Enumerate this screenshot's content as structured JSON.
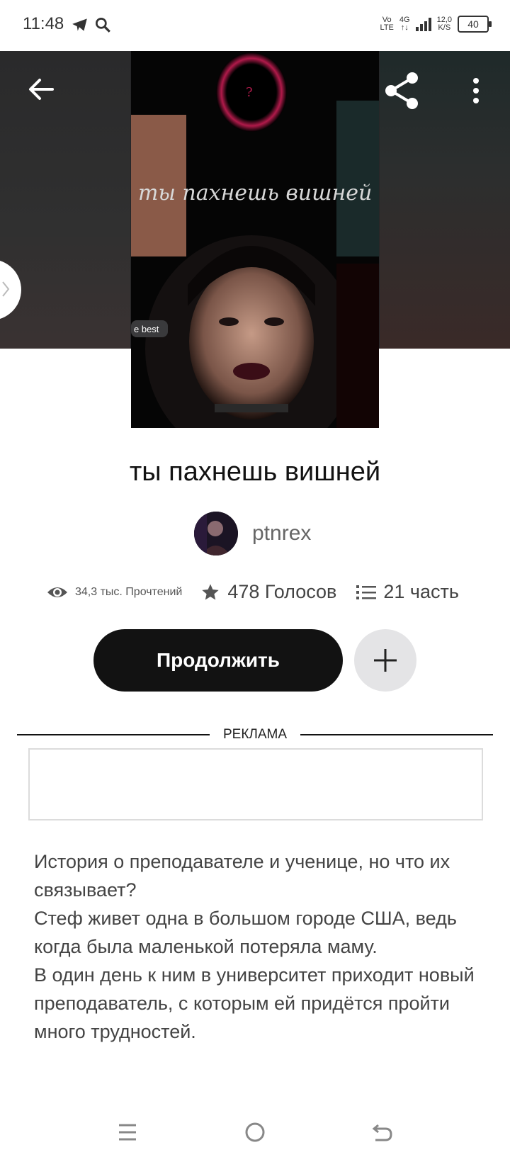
{
  "status_bar": {
    "time": "11:48",
    "icons": [
      "telegram-icon",
      "search-icon"
    ],
    "network_top": "Vo",
    "network_bottom": "LTE",
    "net_type": "4G",
    "speed_value": "12,0",
    "speed_unit": "K/S",
    "battery": "40"
  },
  "header": {
    "back_icon": "arrow-left-icon",
    "share_icon": "share-icon",
    "more_icon": "more-vertical-icon",
    "cover_text": "ты пахнешь вишней",
    "cover_badge": "e best",
    "cover_question": "?"
  },
  "story": {
    "title": "ты пахнешь вишней",
    "author": "ptnrex",
    "reads": "34,3 тыс. Прочтений",
    "votes": "478 Голосов",
    "parts": "21 часть"
  },
  "actions": {
    "continue_label": "Продолжить",
    "add_icon": "plus-icon"
  },
  "ad": {
    "label": "РЕКЛАМА"
  },
  "description": {
    "paragraphs": [
      "История о преподавателе и ученице, но что их связывает?",
      "Стеф живет одна в большом городе США, ведь когда была маленькой потеряла маму.",
      "В один день к ним в университет приходит новый преподаватель, с которым ей придётся пройти много трудностей."
    ]
  },
  "nav": {
    "icons": [
      "menu-icon",
      "home-circle-icon",
      "back-gesture-icon"
    ]
  },
  "colors": {
    "primary_button": "#121212",
    "add_button": "#e4e4e6",
    "header_band": "#262628",
    "text_secondary": "#444444"
  }
}
